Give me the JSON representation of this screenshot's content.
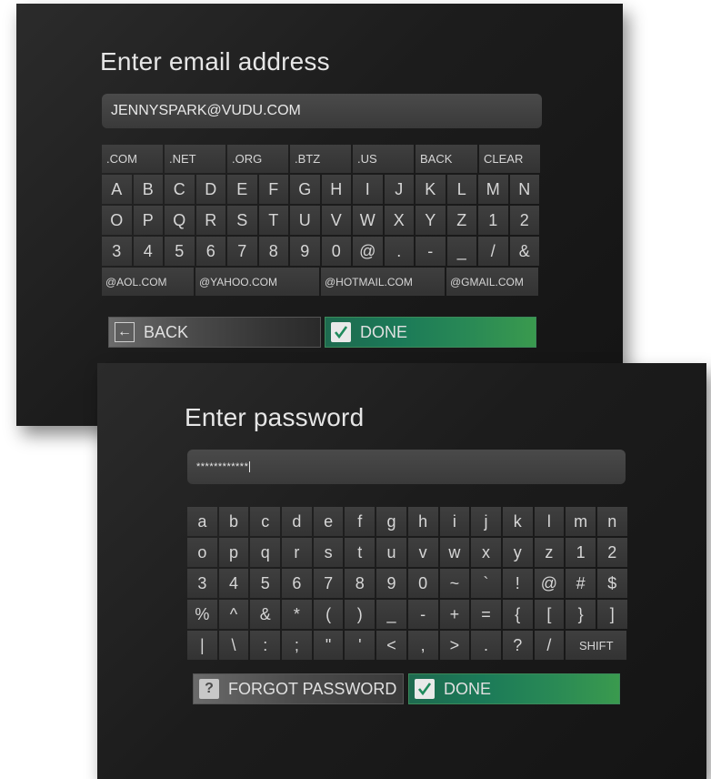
{
  "email_panel": {
    "title": "Enter email address",
    "field_value": "JENNYSPARK@VUDU.COM",
    "domain_keys": [
      ".COM",
      ".NET",
      ".ORG",
      ".BTZ",
      ".US",
      "BACK",
      "CLEAR"
    ],
    "letter_rows": [
      [
        "A",
        "B",
        "C",
        "D",
        "E",
        "F",
        "G",
        "H",
        "I",
        "J",
        "K",
        "L",
        "M",
        "N"
      ],
      [
        "O",
        "P",
        "Q",
        "R",
        "S",
        "T",
        "U",
        "V",
        "W",
        "X",
        "Y",
        "Z",
        "1",
        "2"
      ],
      [
        "3",
        "4",
        "5",
        "6",
        "7",
        "8",
        "9",
        "0",
        "@",
        ".",
        "-",
        "_",
        "/",
        "&"
      ]
    ],
    "provider_keys": [
      "@AOL.COM",
      "@YAHOO.COM",
      "@HOTMAIL.COM",
      "@GMAIL.COM"
    ],
    "back_label": "BACK",
    "done_label": "DONE"
  },
  "password_panel": {
    "title": "Enter password",
    "field_value": "************",
    "key_rows": [
      [
        "a",
        "b",
        "c",
        "d",
        "e",
        "f",
        "g",
        "h",
        "i",
        "j",
        "k",
        "l",
        "m",
        "n"
      ],
      [
        "o",
        "p",
        "q",
        "r",
        "s",
        "t",
        "u",
        "v",
        "w",
        "x",
        "y",
        "z",
        "1",
        "2"
      ],
      [
        "3",
        "4",
        "5",
        "6",
        "7",
        "8",
        "9",
        "0",
        "~",
        "`",
        "!",
        "@",
        "#",
        "$"
      ],
      [
        "%",
        "^",
        "&",
        "*",
        "(",
        ")",
        "_",
        "-",
        "+",
        "=",
        "{",
        "[",
        "}",
        "]"
      ],
      [
        "|",
        "\\",
        ":",
        ";",
        "\"",
        "'",
        "<",
        ",",
        ">",
        ".",
        "?",
        "/",
        "SHIFT"
      ]
    ],
    "forgot_label": "FORGOT PASSWORD",
    "done_label": "DONE"
  },
  "colors": {
    "panel_background": "#1c1c1c",
    "key_background": "#3a3a3a",
    "done_accent": "#1b7a58",
    "text": "#e6e6e6"
  },
  "icons": {
    "back": "left-arrow-icon",
    "done": "checkmark-icon",
    "forgot": "question-mark-icon"
  }
}
